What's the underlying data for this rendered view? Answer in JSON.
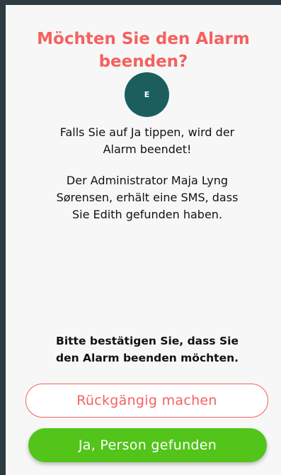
{
  "dialog": {
    "title": "Möchten Sie den Alarm\nbeenden?",
    "avatar_initial": "E",
    "paragraph1": "Falls Sie auf Ja tippen, wird der\nAlarm beendet!",
    "paragraph2": "Der Administrator Maja Lyng\nSørensen, erhält eine SMS, dass\nSie Edith gefunden haben.",
    "confirm_text": "Bitte bestätigen Sie, dass Sie\nden Alarm beenden möchten.",
    "undo_button": "Rückgängig machen",
    "confirm_button": "Ja, Person gefunden"
  },
  "colors": {
    "accent": "#f4615f",
    "primary": "#52c41a",
    "avatar": "#1c5e5e",
    "frame": "#2f3b42"
  }
}
